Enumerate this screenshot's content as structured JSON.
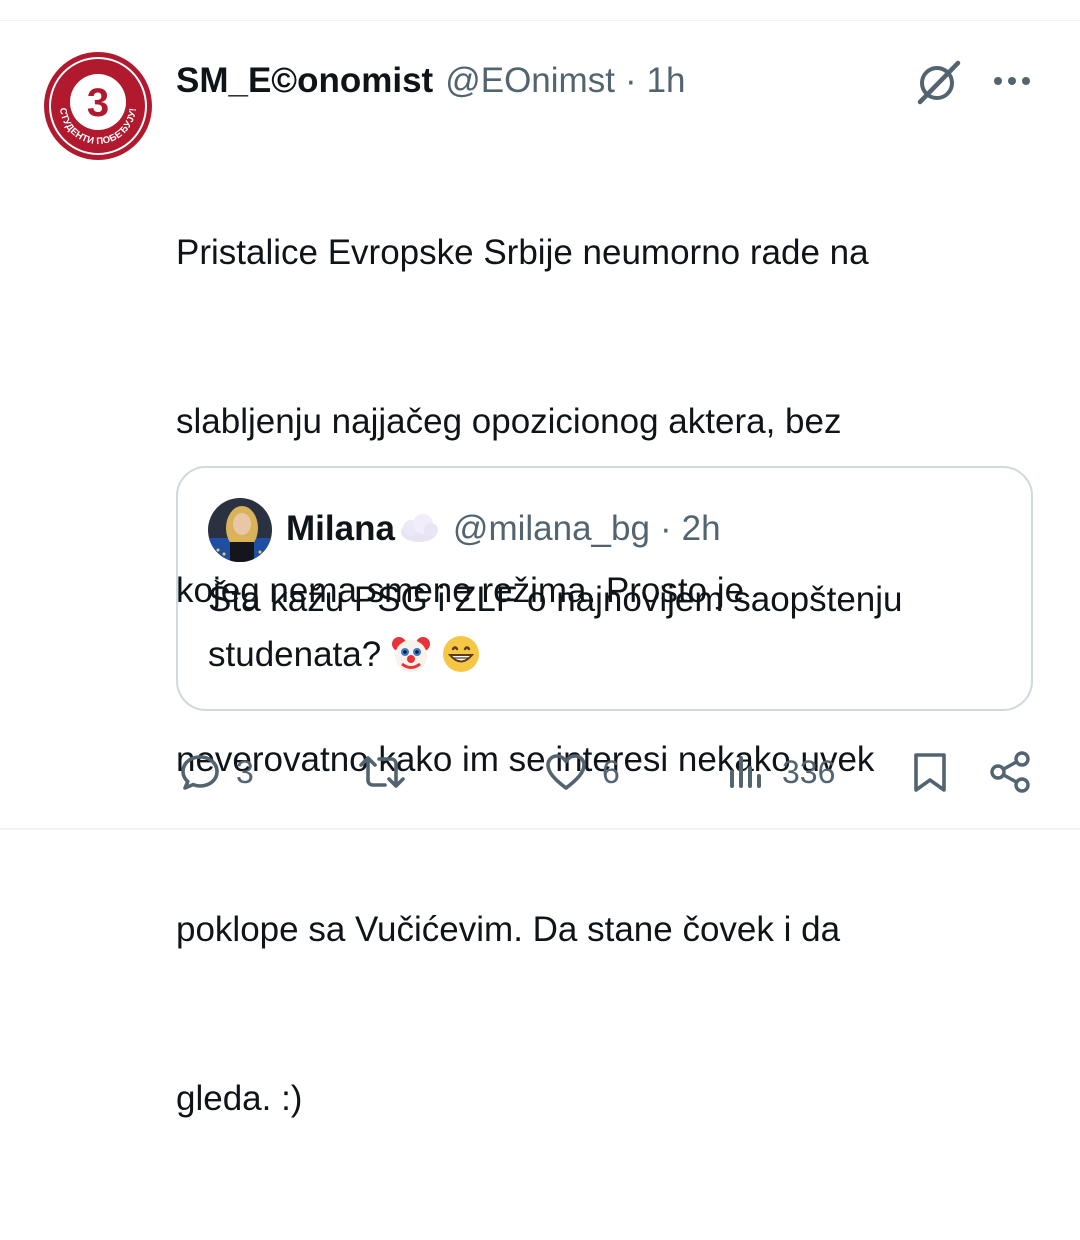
{
  "tweet": {
    "display_name": "SM_E©onomist",
    "handle": "@EOnimst",
    "separator": "·",
    "time": "1h",
    "text_lines": [
      "Pristalice Evropske Srbije neumorno rade na",
      "slabljenju najjačeg opozicionog aktera, bez",
      "kojeg nema smene režima. Prosto je",
      "neverovatno kako im se interesi nekako uvek",
      "poklope sa Vučićevim. Da stane čovek i da",
      "gleda. :)"
    ],
    "avatar": {
      "badge_number": "3",
      "ring_text": "СТУДЕНТИ ПОБЕЂУЈУ!",
      "brand_color": "#b0192e"
    }
  },
  "quote": {
    "display_name": "Milana",
    "name_icon": "cloud-icon",
    "handle": "@milana_bg",
    "separator": "·",
    "time": "2h",
    "text_line1": "Šta kažu PSG i ZLF o najnovijem saopštenju",
    "text_line2": "studenata?",
    "emojis": [
      "clown-face-emoji",
      "grinning-face-emoji"
    ]
  },
  "actions": {
    "reply": {
      "icon": "reply-icon",
      "count": "3"
    },
    "retweet": {
      "icon": "retweet-icon",
      "count": ""
    },
    "like": {
      "icon": "heart-icon",
      "count": "6"
    },
    "views": {
      "icon": "views-icon",
      "count": "336"
    },
    "bookmark": {
      "icon": "bookmark-icon"
    },
    "share": {
      "icon": "share-icon"
    }
  },
  "colors": {
    "text_primary": "#0f1419",
    "text_secondary": "#536471",
    "border": "#cfd9de"
  }
}
